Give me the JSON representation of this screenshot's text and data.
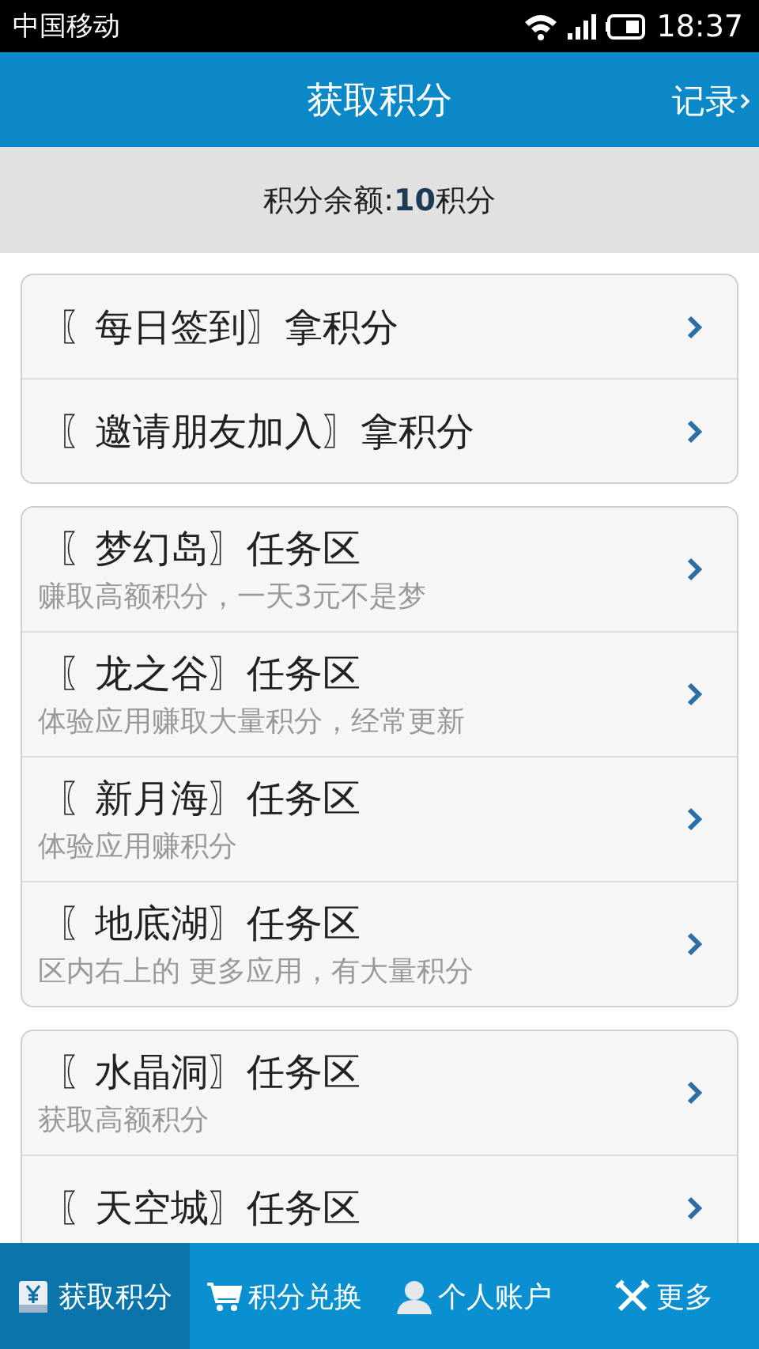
{
  "status_bar": {
    "carrier": "中国移动",
    "time": "18:37"
  },
  "header": {
    "title": "获取积分",
    "action": "记录"
  },
  "balance": {
    "text": "积分余额:**10**积分"
  },
  "groups": [
    {
      "items": [
        {
          "title": "〖每日签到〗拿积分"
        },
        {
          "title": "〖邀请朋友加入〗拿积分"
        }
      ]
    },
    {
      "items": [
        {
          "title": "〖梦幻岛〗任务区",
          "subtitle": "赚取高额积分，一天3元不是梦"
        },
        {
          "title": "〖龙之谷〗任务区",
          "subtitle": "体验应用赚取大量积分，经常更新"
        },
        {
          "title": "〖新月海〗任务区",
          "subtitle": "体验应用赚积分"
        },
        {
          "title": "〖地底湖〗任务区",
          "subtitle": "区内右上的 更多应用，有大量积分"
        }
      ]
    },
    {
      "items": [
        {
          "title": "〖水晶洞〗任务区",
          "subtitle": "获取高额积分"
        },
        {
          "title": "〖天空城〗任务区"
        }
      ]
    }
  ],
  "nav": [
    {
      "label": "获取积分",
      "selected": true
    },
    {
      "label": "积分兑换",
      "selected": false
    },
    {
      "label": "个人账户",
      "selected": false
    },
    {
      "label": "更多",
      "selected": false
    }
  ]
}
